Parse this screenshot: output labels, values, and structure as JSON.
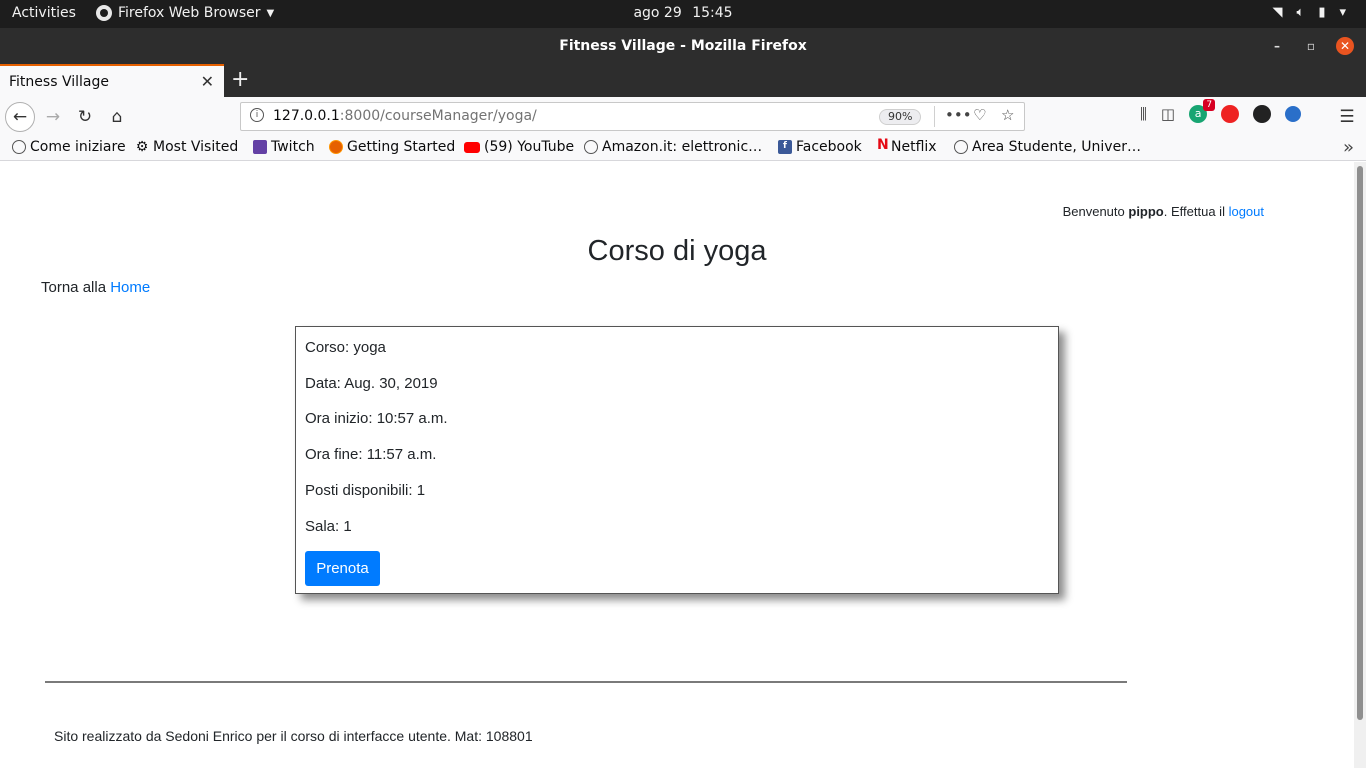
{
  "system_bar": {
    "activities": "Activities",
    "app_menu": "Firefox Web Browser",
    "date": "ago 29",
    "time": "15:45"
  },
  "window": {
    "title": "Fitness Village - Mozilla Firefox"
  },
  "tabs": [
    {
      "label": "Fitness Village",
      "active": true
    }
  ],
  "navbar": {
    "url_host": "127.0.0.1",
    "url_path": ":8000/courseManager/yoga/",
    "zoom": "90%",
    "extension_badge": "7"
  },
  "bookmarks": [
    {
      "label": "Come iniziare",
      "icon": "globe-icon"
    },
    {
      "label": "Most Visited",
      "icon": "gear-icon"
    },
    {
      "label": "Twitch",
      "icon": "twitch-icon"
    },
    {
      "label": "Getting Started",
      "icon": "firefox-icon"
    },
    {
      "label": "(59) YouTube",
      "icon": "youtube-icon"
    },
    {
      "label": "Amazon.it: elettronic…",
      "icon": "globe-icon"
    },
    {
      "label": "Facebook",
      "icon": "facebook-icon"
    },
    {
      "label": "Netflix",
      "icon": "netflix-icon"
    },
    {
      "label": "Area Studente, Univer…",
      "icon": "globe-icon"
    }
  ],
  "page": {
    "welcome_prefix": "Benvenuto",
    "username": "pippo",
    "welcome_middle": ". Effettua il",
    "logout_label": "logout",
    "title": "Corso di yoga",
    "back_prefix": "Torna alla",
    "home_link": "Home",
    "course": {
      "corso": "Corso: yoga",
      "data": "Data: Aug. 30, 2019",
      "ora_inizio": "Ora inizio: 10:57 a.m.",
      "ora_fine": "Ora fine: 11:57 a.m.",
      "posti": "Posti disponibili: 1",
      "sala": "Sala: 1",
      "button": "Prenota"
    },
    "footer": "Sito realizzato da Sedoni Enrico per il corso di interfacce utente. Mat: 108801"
  },
  "colors": {
    "link": "#007bff",
    "button": "#007bff",
    "tab_accent": "#e66000",
    "close_button": "#e95420"
  }
}
